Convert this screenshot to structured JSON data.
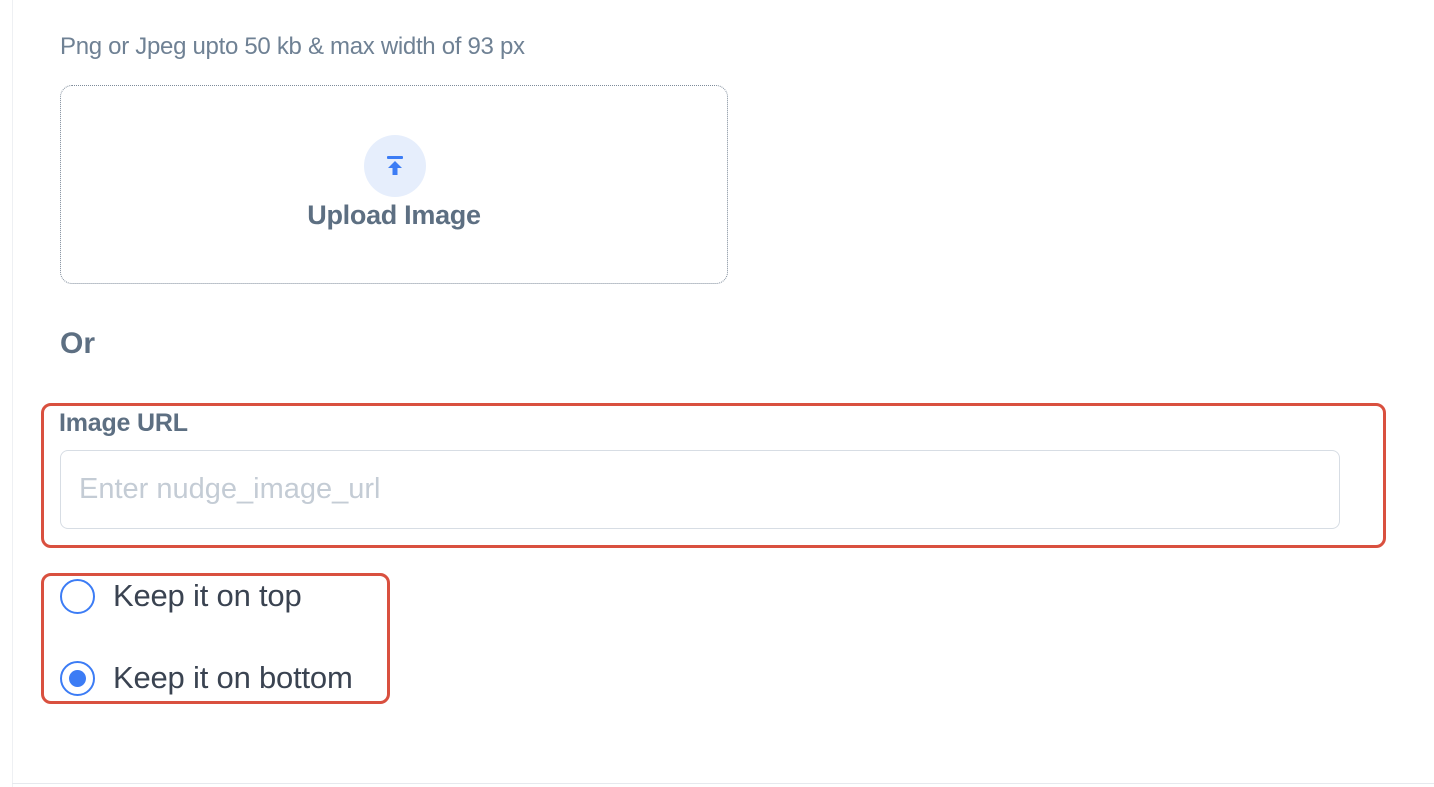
{
  "upload": {
    "hint": "Png or Jpeg upto 50 kb & max width of 93 px",
    "icon": "upload-arrow-icon",
    "label": "Upload Image"
  },
  "separator": {
    "label": "Or"
  },
  "image_url": {
    "label": "Image URL",
    "value": "",
    "placeholder": "Enter nudge_image_url"
  },
  "position": {
    "options": [
      {
        "label": "Keep it on top",
        "selected": false
      },
      {
        "label": "Keep it on bottom",
        "selected": true
      }
    ]
  },
  "colors": {
    "accent": "#3c7cf5",
    "highlight": "#d9503f"
  }
}
